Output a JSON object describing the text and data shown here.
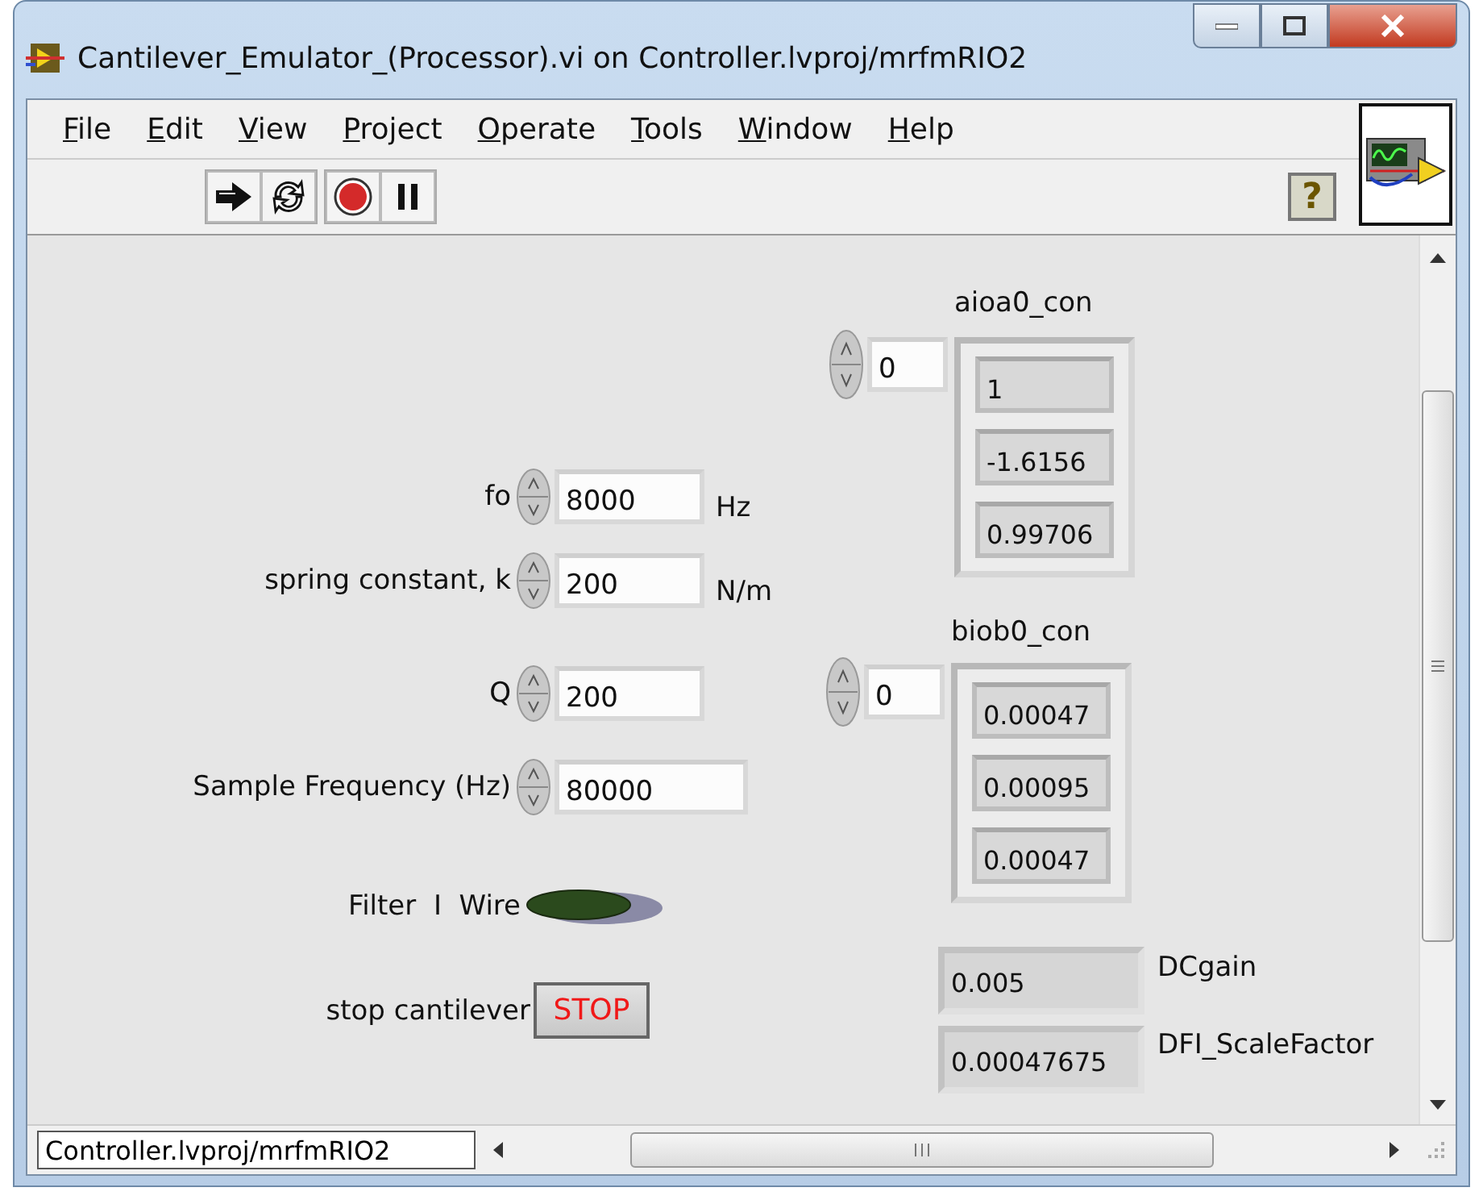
{
  "window": {
    "title": "Cantilever_Emulator_(Processor).vi on Controller.lvproj/mrfmRIO2"
  },
  "menu": [
    {
      "label": "File"
    },
    {
      "label": "Edit"
    },
    {
      "label": "View"
    },
    {
      "label": "Project"
    },
    {
      "label": "Operate"
    },
    {
      "label": "Tools"
    },
    {
      "label": "Window"
    },
    {
      "label": "Help"
    }
  ],
  "toolbar": {
    "help_button": "?"
  },
  "numerics": [
    {
      "label": "fo",
      "value": "8000",
      "unit": "Hz"
    },
    {
      "label": "spring constant, k",
      "value": "200",
      "unit": "N/m"
    },
    {
      "label": "Q",
      "value": "200"
    },
    {
      "label": "Sample Frequency (Hz)",
      "value": "80000"
    }
  ],
  "arrays": [
    {
      "label": "aioa0_con",
      "index": "0",
      "values": [
        "1",
        "-1.6156",
        "0.99706"
      ]
    },
    {
      "label": "biob0_con",
      "index": "0",
      "values": [
        "0.00047",
        "0.00095",
        "0.00047"
      ]
    }
  ],
  "led": {
    "label": "Filter  I  Wire",
    "on": false
  },
  "stop": {
    "label": "stop cantilever",
    "button": "STOP"
  },
  "indicators": [
    {
      "label": "DCgain",
      "value": "0.005"
    },
    {
      "label": "DFI_ScaleFactor",
      "value": "0.00047675"
    }
  ],
  "status_bar": {
    "target": "Controller.lvproj/mrfmRIO2"
  }
}
